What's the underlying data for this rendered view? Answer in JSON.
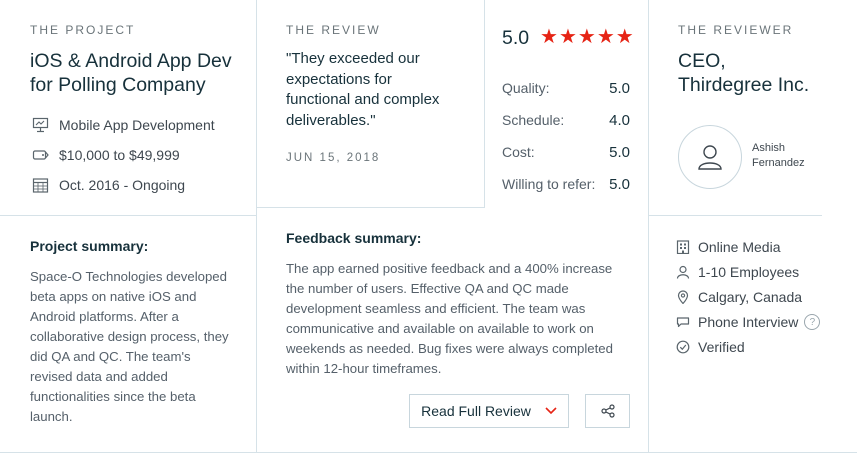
{
  "project": {
    "eyebrow": "THE PROJECT",
    "title_line1": "iOS & Android App Dev",
    "title_line2": "for Polling Company",
    "service": "Mobile App Development",
    "budget": "$10,000 to $49,999",
    "timeline": "Oct. 2016 - Ongoing",
    "summary_heading": "Project summary:",
    "summary_lines": [
      "Space-O Technologies developed",
      "beta apps on native iOS and",
      "Android platforms. After a",
      "collaborative design process, they",
      "did QA and QC. The team's",
      "revised data and added",
      "functionalities since the beta",
      "launch."
    ]
  },
  "review": {
    "eyebrow": "THE REVIEW",
    "quote_lines": [
      "\"They exceeded our",
      "expectations for",
      "functional and complex",
      "deliverables.\""
    ],
    "date": "JUN 15, 2018",
    "overall_score": "5.0",
    "stars": 5,
    "scores": [
      {
        "label": "Quality:",
        "value": "5.0"
      },
      {
        "label": "Schedule:",
        "value": "4.0"
      },
      {
        "label": "Cost:",
        "value": "5.0"
      },
      {
        "label": "Willing to refer:",
        "value": "5.0"
      }
    ],
    "feedback_heading": "Feedback summary:",
    "feedback_lines": [
      "The app earned positive feedback and a 400% increase",
      "the number of users. Effective QA and QC made",
      "development seamless and efficient. The team was",
      "communicative and available on available to work on",
      "weekends as needed. Bug fixes were always completed",
      "within 12-hour timeframes."
    ],
    "read_more_label": "Read Full Review"
  },
  "reviewer": {
    "eyebrow": "THE REVIEWER",
    "title_line1": "CEO,",
    "title_line2": "Thirdegree Inc.",
    "name_line1": "Ashish",
    "name_line2": "Fernandez",
    "industry": "Online Media",
    "size": "1-10 Employees",
    "location": "Calgary, Canada",
    "review_type": "Phone Interview",
    "verification": "Verified",
    "help_glyph": "?"
  },
  "colors": {
    "star": "#e62415",
    "border": "#d6e2e8",
    "heading": "#17313b"
  }
}
